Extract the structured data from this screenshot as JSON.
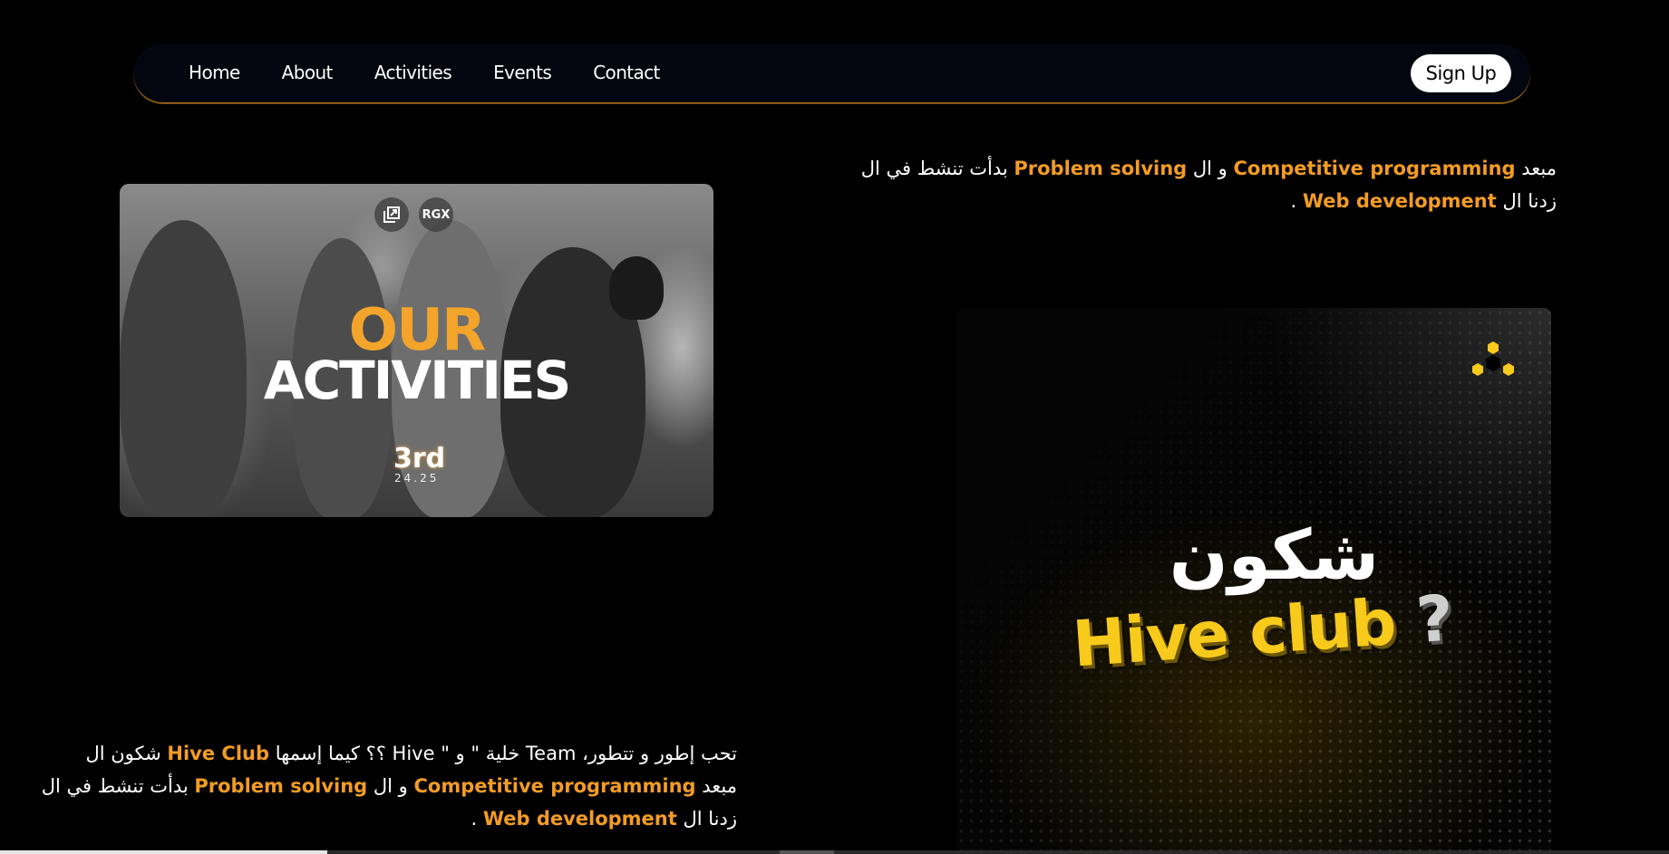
{
  "nav": {
    "links": [
      "Home",
      "About",
      "Activities",
      "Events",
      "Contact"
    ],
    "signup_label": "Sign Up"
  },
  "intro_top": {
    "line1": {
      "prefix": "مبعد",
      "highlight1": "Competitive programming",
      "middle": "و ال",
      "highlight2": "Problem solving",
      "suffix": "بدأت تنشط في ال"
    },
    "line2": {
      "prefix": "زدنا ال",
      "highlight": "Web development",
      "suffix": "."
    }
  },
  "activities_card": {
    "title_line1": "OUR",
    "title_line2": "ACTIVITIES",
    "edition": "3rd",
    "season": "24.25",
    "badge": "RGX",
    "icons": [
      "open-in-new-icon",
      "rgx-badge-icon"
    ]
  },
  "hive_panel": {
    "title_ar": "شكون",
    "title_en": "Hive club",
    "question_mark": "?",
    "logo": "hexagon-dots-logo"
  },
  "about_bottom": {
    "line1": {
      "part1": "تحب إطور و تتطور، Team خلية \" و \" Hive ؟؟ كيما إسمها",
      "highlight": "Hive Club",
      "part2": "شكون ال"
    },
    "line2": {
      "prefix": "مبعد",
      "highlight1": "Competitive programming",
      "middle": "و ال",
      "highlight2": "Problem solving",
      "suffix": "بدأت تنشط في ال"
    },
    "line3": {
      "prefix": "زدنا ال",
      "highlight": "Web development",
      "suffix": "."
    }
  },
  "colors": {
    "accent": "#f39c24",
    "hive_yellow": "#f7ca1b",
    "nav_border": "#a66a14",
    "background": "#000000"
  },
  "scroll": {
    "position_fraction": 0.0
  }
}
